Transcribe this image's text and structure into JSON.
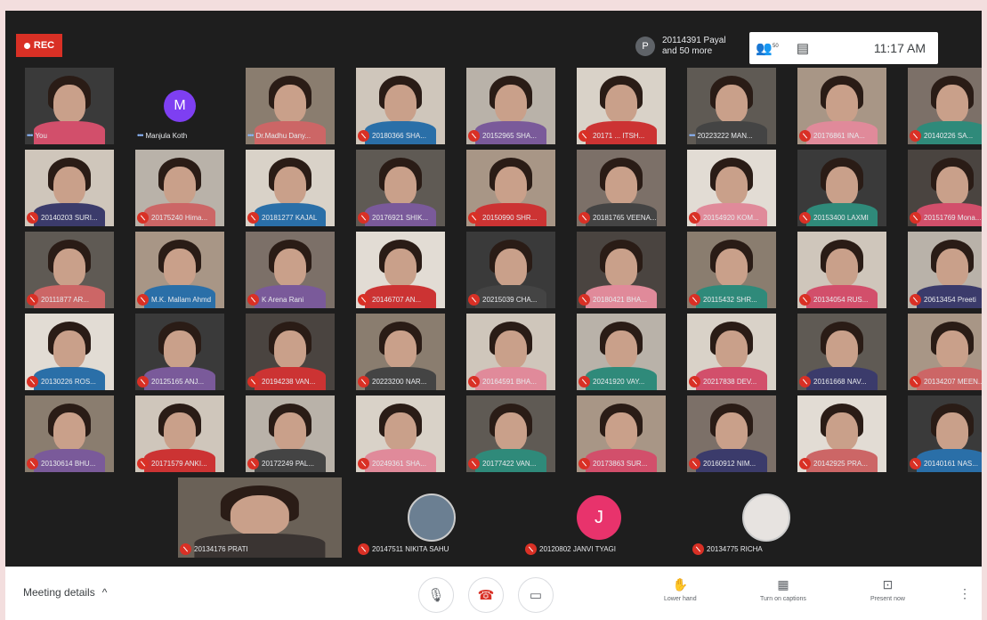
{
  "header": {
    "rec_label": "REC",
    "presenter": {
      "avatar_initial": "P",
      "line1": "20114391 Payal",
      "line2": "and 50 more"
    },
    "people_count": "50",
    "time": "11:17 AM"
  },
  "tiles": {
    "r1": [
      "You",
      "Manjula Koth",
      "Dr.Madhu Dany...",
      "20180366 SHA...",
      "20152965 SHA...",
      "20171 ... ITSH...",
      "20223222 MAN...",
      "20176861 INA...",
      "20140226 SA..."
    ],
    "r2": [
      "20140203 SURI...",
      "20175240 Hima...",
      "20181277 KAJAL",
      "20176921 SHIK...",
      "20150990 SHR...",
      "20181765 VEENA...",
      "20154920 KOM...",
      "20153400 LAXMI",
      "20151769 Mona..."
    ],
    "r3": [
      "20111877 AR...",
      "M.K. Mallam Ahmd",
      "K Arena Rani",
      "20146707 AN...",
      "20215039 CHA...",
      "20180421 BHA...",
      "20115432 SHR...",
      "20134054 RUS...",
      "20613454 Preeti"
    ],
    "r4": [
      "20130226 ROS...",
      "20125165 ANJ...",
      "20194238 VAN...",
      "20223200 NAR...",
      "20164591 BHA...",
      "20241920 VAY...",
      "20217838 DEV...",
      "20161668 NAV...",
      "20134207 MEEN..."
    ],
    "r5": [
      "20130614 BHU...",
      "20171579 ANKI...",
      "20172249 PAL...",
      "20249361 SHA...",
      "20177422 VAN...",
      "20173863 SUR...",
      "20160912 NIM...",
      "20142925 PRA...",
      "20140161 NAS..."
    ],
    "r6": [
      "20134176 PRATI",
      "20147511 NIKITA SAHU",
      "20120802 JANVI TYAGI",
      "20134775 RICHA"
    ]
  },
  "avatars": {
    "manjula_initial": "M",
    "janvi_initial": "J"
  },
  "bottom": {
    "meeting_details": "Meeting details",
    "raise_hand": "Lower hand",
    "captions": "Turn on captions",
    "present": "Present now"
  },
  "colors": {
    "record_red": "#d93025",
    "avatar_purple": "#7e3ff2",
    "avatar_pink": "#e8336c",
    "bg": "#1e1e1e"
  }
}
